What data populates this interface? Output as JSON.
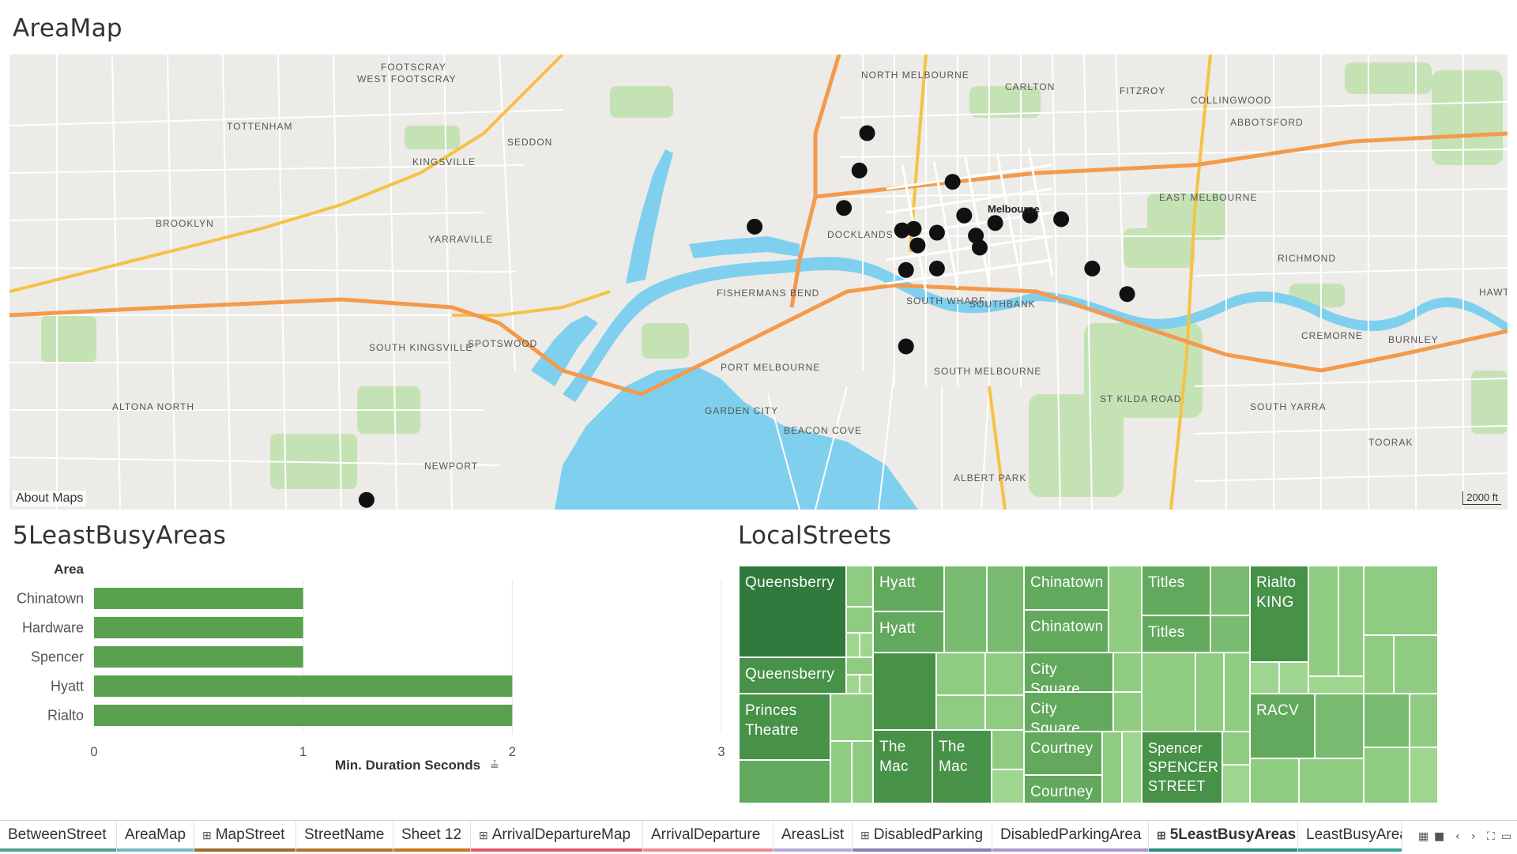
{
  "titles": {
    "area_map": "AreaMap",
    "least_busy": "5LeastBusyAreas",
    "local_streets": "LocalStreets"
  },
  "map": {
    "credit": "About Maps",
    "scale_label": "2000 ft",
    "places": {
      "footscray": "FOOTSCRAY",
      "west_footscray": "WEST FOOTSCRAY",
      "tottenham": "TOTTENHAM",
      "seddon": "SEDDON",
      "kingsville": "KINGSVILLE",
      "brooklyn": "BROOKLYN",
      "yarraville": "YARRAVILLE",
      "spotswood": "SPOTSWOOD",
      "south_kingsville": "SOUTH KINGSVILLE",
      "altona_north": "ALTONA NORTH",
      "newport": "NEWPORT",
      "north_melbourne": "NORTH MELBOURNE",
      "carlton": "CARLTON",
      "fitzroy": "FITZROY",
      "collingwood": "COLLINGWOOD",
      "abbotsford": "ABBOTSFORD",
      "east_melbourne": "EAST MELBOURNE",
      "richmond": "RICHMOND",
      "hawthorn": "HAWTHO",
      "cremorne": "CREMORNE",
      "burnley": "BURNLEY",
      "docklands": "DOCKLANDS",
      "fishermans_bend": "FISHERMANS BEND",
      "south_wharf": "SOUTH WHARF",
      "southbank": "SOUTHBANK",
      "port_melbourne": "PORT MELBOURNE",
      "south_melbourne": "SOUTH MELBOURNE",
      "st_kilda_road": "ST KILDA ROAD",
      "south_yarra": "SOUTH YARRA",
      "toorak": "TOORAK",
      "albert_park": "ALBERT PARK",
      "beacon_cove": "BEACON COVE",
      "garden_city": "GARDEN CITY",
      "melbourne": "Melbourne"
    },
    "points": [
      {
        "lon": 144.9555,
        "lat": -37.8015
      },
      {
        "lon": 144.9545,
        "lat": -37.8065
      },
      {
        "lon": 144.9665,
        "lat": -37.808
      },
      {
        "lon": 144.9525,
        "lat": -37.8115
      },
      {
        "lon": 144.941,
        "lat": -37.814
      },
      {
        "lon": 144.968,
        "lat": -37.8125
      },
      {
        "lon": 144.972,
        "lat": -37.8135
      },
      {
        "lon": 144.9765,
        "lat": -37.8125
      },
      {
        "lon": 144.9805,
        "lat": -37.813
      },
      {
        "lon": 144.96,
        "lat": -37.8145
      },
      {
        "lon": 144.9615,
        "lat": -37.8143
      },
      {
        "lon": 144.9645,
        "lat": -37.8148
      },
      {
        "lon": 144.9695,
        "lat": -37.8152
      },
      {
        "lon": 144.962,
        "lat": -37.8165
      },
      {
        "lon": 144.97,
        "lat": -37.8168
      },
      {
        "lon": 144.9605,
        "lat": -37.8198
      },
      {
        "lon": 144.9645,
        "lat": -37.8196
      },
      {
        "lon": 144.9845,
        "lat": -37.8196
      },
      {
        "lon": 144.989,
        "lat": -37.823
      },
      {
        "lon": 144.9605,
        "lat": -37.83
      },
      {
        "lon": 144.891,
        "lat": -37.8505
      }
    ]
  },
  "chart_data": {
    "type": "bar",
    "orientation": "horizontal",
    "title": "5LeastBusyAreas",
    "category_header": "Area",
    "categories": [
      "Chinatown",
      "Hardware",
      "Spencer",
      "Hyatt",
      "Rialto"
    ],
    "values": [
      1,
      1,
      1,
      2,
      2
    ],
    "xlabel": "Min. Duration Seconds",
    "xticks": [
      "0",
      "1",
      "2",
      "3"
    ],
    "xlim": [
      0,
      3
    ],
    "color": "#59a14f"
  },
  "treemap": {
    "labels": {
      "queensberry": "Queensberry",
      "princes_theatre_a": "Princes",
      "princes_theatre_b": "Theatre",
      "hyatt": "Hyatt",
      "the_mac_a": "The",
      "the_mac_b": "Mac",
      "chinatown": "Chinatown",
      "city_square": "City Square",
      "courtney": "Courtney",
      "titles": "Titles",
      "spencer_a": "Spencer",
      "spencer_b": "SPENCER",
      "spencer_c": "STREET",
      "rialto_a": "Rialto",
      "rialto_b": "KING",
      "racv": "RACV"
    },
    "colors": {
      "darkest": "#2f7a3c",
      "dark": "#479149",
      "medium": "#62a95d",
      "mid_light": "#79bb70",
      "light": "#8fcc82",
      "lightest": "#9fd68f"
    }
  },
  "tabs": [
    {
      "label": "BetweenStreet",
      "icon": "",
      "color": "#4e9f8f"
    },
    {
      "label": "AreaMap",
      "icon": "",
      "color": "#75b7c2"
    },
    {
      "label": "MapStreet",
      "icon": "grid-icon",
      "color": "#9c6a2f"
    },
    {
      "label": "StreetName",
      "icon": "",
      "color": "#b0722a"
    },
    {
      "label": "Sheet 12",
      "icon": "",
      "color": "#c4751f"
    },
    {
      "label": "ArrivalDepartureMap",
      "icon": "grid-icon",
      "color": "#e15a6b"
    },
    {
      "label": "ArrivalDeparture",
      "icon": "",
      "color": "#e98a8f"
    },
    {
      "label": "AreasList",
      "icon": "",
      "color": "#b6a7d6"
    },
    {
      "label": "DisabledParking",
      "icon": "grid-icon",
      "color": "#8b7cb7"
    },
    {
      "label": "DisabledParkingArea",
      "icon": "",
      "color": "#aa96d0"
    },
    {
      "label": "5LeastBusyAreas",
      "icon": "grid-icon",
      "color": "#2b8c7e",
      "active": true
    },
    {
      "label": "LeastBusyArea",
      "icon": "",
      "color": "#3aa497"
    }
  ]
}
